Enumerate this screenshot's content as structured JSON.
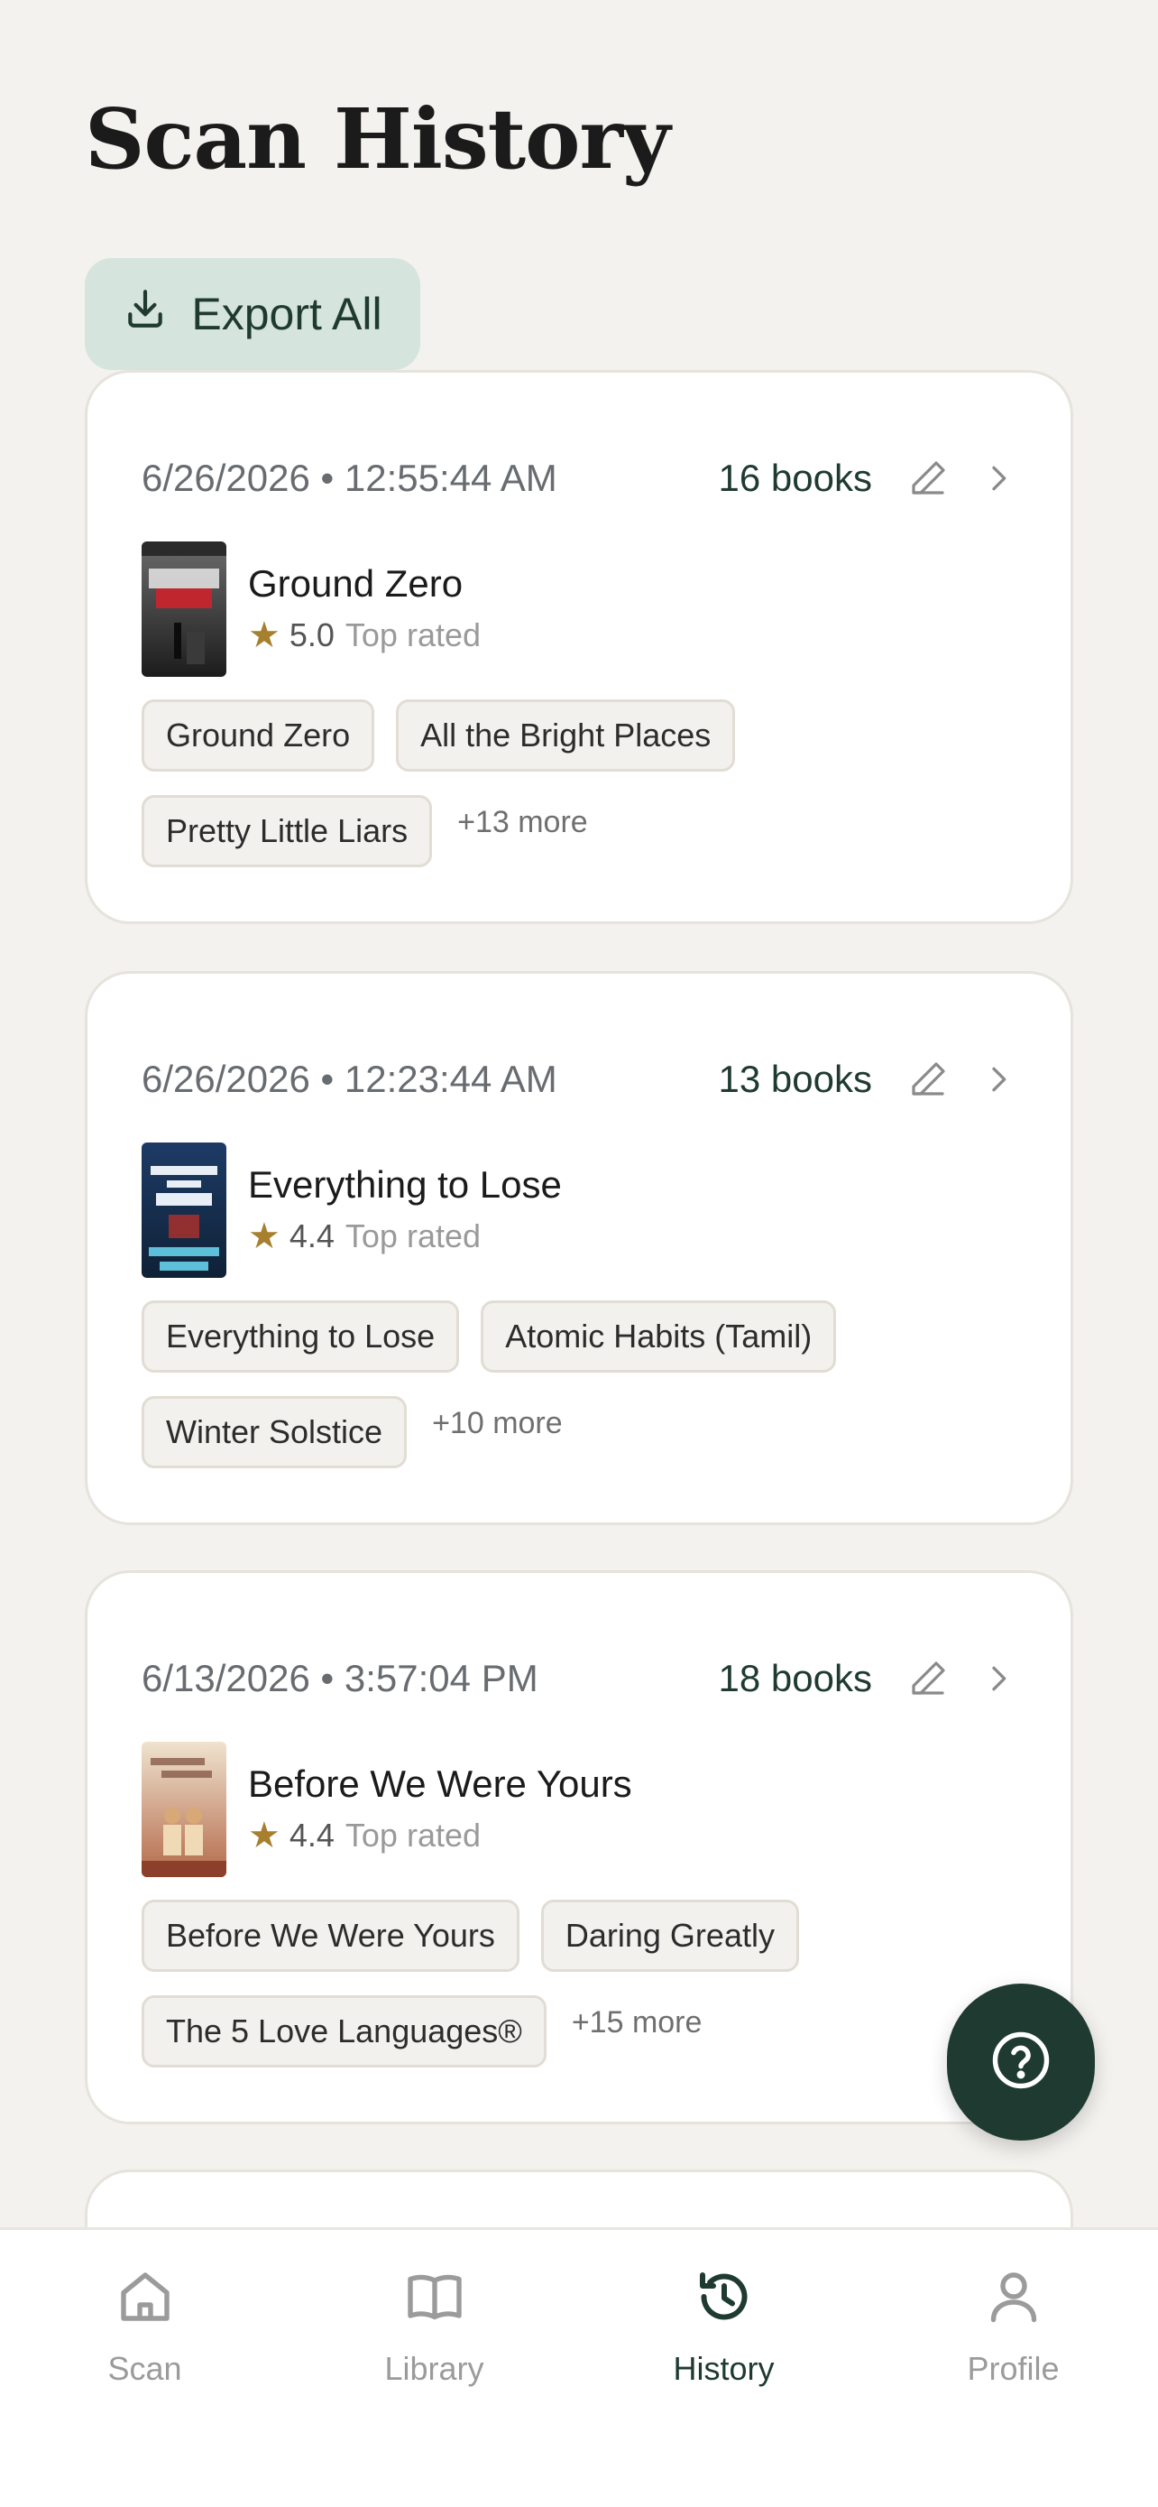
{
  "page": {
    "title": "Scan History",
    "export_label": "Export All"
  },
  "colors": {
    "accent_dark": "#1f3a31",
    "export_bg": "#d5e4dc",
    "star": "#a7802f",
    "background": "#f3f2ee"
  },
  "sessions": [
    {
      "timestamp": "6/26/2026 • 12:55:44 AM",
      "count": "16 books",
      "top_book": {
        "title": "Ground Zero",
        "rating": "5.0",
        "badge": "Top rated"
      },
      "chips": [
        "Ground Zero",
        "All the Bright Places",
        "Pretty Little Liars"
      ],
      "more": "+13 more"
    },
    {
      "timestamp": "6/26/2026 • 12:23:44 AM",
      "count": "13 books",
      "top_book": {
        "title": "Everything to Lose",
        "rating": "4.4",
        "badge": "Top rated"
      },
      "chips": [
        "Everything to Lose",
        "Atomic Habits (Tamil)",
        "Winter Solstice"
      ],
      "more": "+10 more"
    },
    {
      "timestamp": "6/13/2026 • 3:57:04 PM",
      "count": "18 books",
      "top_book": {
        "title": "Before We Were Yours",
        "rating": "4.4",
        "badge": "Top rated"
      },
      "chips": [
        "Before We Were Yours",
        "Daring Greatly",
        "The 5 Love Languages®"
      ],
      "more": "+15 more"
    }
  ],
  "nav": {
    "items": [
      {
        "label": "Scan",
        "icon": "home-icon"
      },
      {
        "label": "Library",
        "icon": "book-icon"
      },
      {
        "label": "History",
        "icon": "history-icon",
        "active": true
      },
      {
        "label": "Profile",
        "icon": "person-icon"
      }
    ]
  }
}
